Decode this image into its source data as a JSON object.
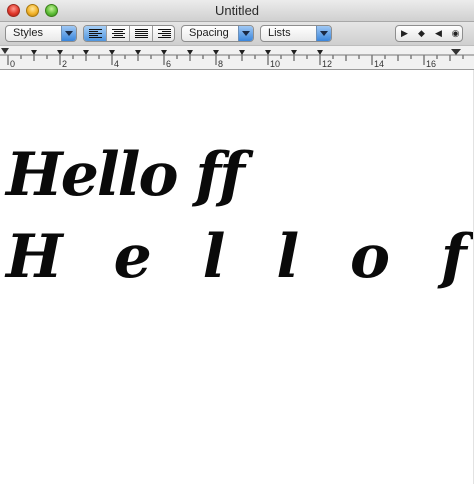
{
  "window": {
    "title": "Untitled"
  },
  "toolbar": {
    "styles_label": "Styles",
    "spacing_label": "Spacing",
    "lists_label": "Lists",
    "alignment_selected": "left"
  },
  "ruler": {
    "major_labels": [
      "0",
      "2",
      "4",
      "6",
      "8",
      "10",
      "12",
      "14",
      "16"
    ]
  },
  "document": {
    "lines": [
      "Hello ff",
      "H e l l o f f"
    ]
  }
}
